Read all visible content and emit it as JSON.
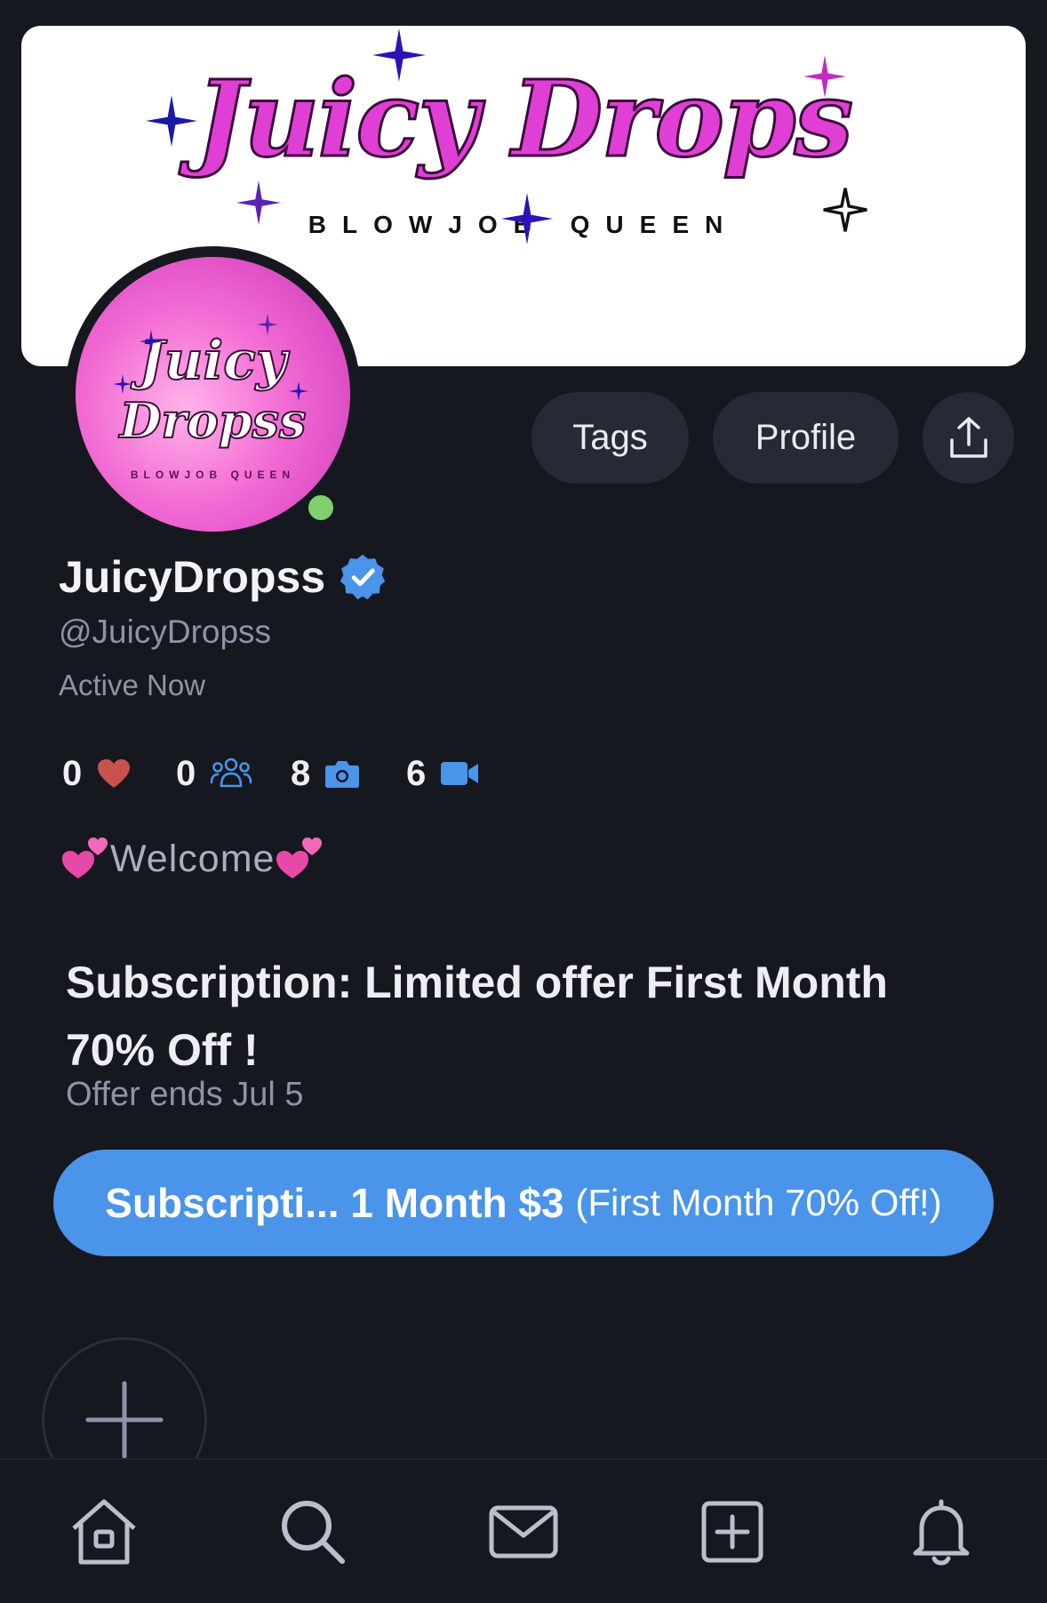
{
  "banner": {
    "title": "Juicy Drops",
    "subtitle": "BLOWJOB QUEEN"
  },
  "avatar": {
    "line1": "Juicy",
    "line2": "Dropss",
    "tagline": "BLOWJOB QUEEN",
    "status_color": "#7fcf6e"
  },
  "actions": {
    "tags_label": "Tags",
    "profile_label": "Profile",
    "share_icon": "share-icon"
  },
  "profile": {
    "display_name": "JuicyDropss",
    "handle": "@JuicyDropss",
    "status": "Active Now",
    "verified": true
  },
  "stats": [
    {
      "value": "0",
      "icon": "heart-icon"
    },
    {
      "value": "0",
      "icon": "people-icon"
    },
    {
      "value": "8",
      "icon": "camera-icon"
    },
    {
      "value": "6",
      "icon": "video-icon"
    }
  ],
  "welcome": {
    "text": "Welcome"
  },
  "subscription": {
    "title": "Subscription: Limited offer First Month 70% Off !",
    "ends": "Offer ends Jul 5",
    "button_name": "Subscripti...",
    "button_period": "1 Month",
    "button_price": "$3",
    "button_note": "(First Month 70% Off!)"
  },
  "colors": {
    "background": "#16181f",
    "accent": "#4a94e9",
    "pill": "#262a34",
    "heart": "#c9524d",
    "brand_pink": "#e03fd6"
  },
  "nav": [
    "home-icon",
    "search-icon",
    "mail-icon",
    "add-post-icon",
    "bell-icon"
  ]
}
